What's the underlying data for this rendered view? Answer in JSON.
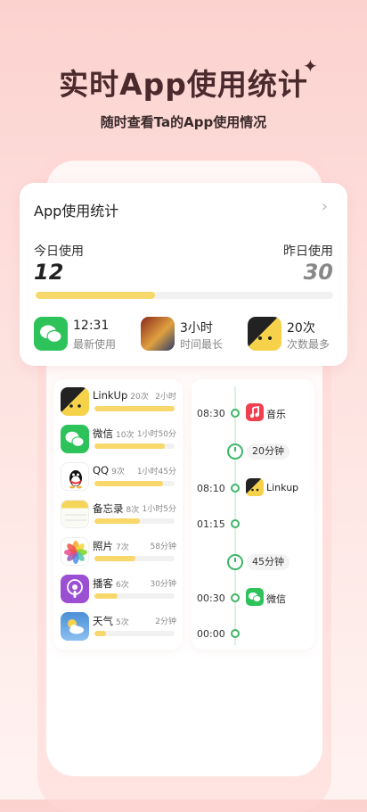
{
  "hero": {
    "title": "实时App使用统计",
    "subtitle": "随时查看Ta的App使用情况"
  },
  "summary": {
    "title": "App使用统计",
    "today_label": "今日使用",
    "today_value": "12",
    "yesterday_label": "昨日使用",
    "yesterday_value": "30",
    "progress_fraction": 0.4,
    "stats": [
      {
        "value": "12:31",
        "label": "最新使用",
        "icon": "wechat-icon"
      },
      {
        "value": "3小时",
        "label": "时间最长",
        "icon": "game-icon"
      },
      {
        "value": "20次",
        "label": "次数最多",
        "icon": "linkup-icon"
      }
    ]
  },
  "apps": [
    {
      "name": "LinkUp",
      "count": "20次",
      "duration": "2小时",
      "fraction": 1.0,
      "icon": "linkup-icon"
    },
    {
      "name": "微信",
      "count": "10次",
      "duration": "1小时50分",
      "fraction": 0.88,
      "icon": "wechat-icon"
    },
    {
      "name": "QQ",
      "count": "9次",
      "duration": "1小时45分",
      "fraction": 0.85,
      "icon": "qq-icon"
    },
    {
      "name": "备忘录",
      "count": "8次",
      "duration": "1小时5分",
      "fraction": 0.57,
      "icon": "notes-icon"
    },
    {
      "name": "照片",
      "count": "7次",
      "duration": "58分钟",
      "fraction": 0.51,
      "icon": "photos-icon"
    },
    {
      "name": "播客",
      "count": "6次",
      "duration": "30分钟",
      "fraction": 0.29,
      "icon": "podcast-icon"
    },
    {
      "name": "天气",
      "count": "5次",
      "duration": "2分钟",
      "fraction": 0.14,
      "icon": "weather-icon"
    }
  ],
  "timeline": [
    {
      "time": "08:30",
      "app": "音乐",
      "icon": "music-icon"
    },
    {
      "duration": "20分钟"
    },
    {
      "time": "08:10",
      "app": "Linkup",
      "icon": "linkup-icon"
    },
    {
      "time": "01:15"
    },
    {
      "duration": "45分钟"
    },
    {
      "time": "00:30",
      "app": "微信",
      "icon": "wechat-icon"
    },
    {
      "time": "00:00"
    }
  ],
  "colors": {
    "accent_yellow": "#f8d86a",
    "timeline_green": "#3db665",
    "title_brown": "#4a2a2c"
  }
}
